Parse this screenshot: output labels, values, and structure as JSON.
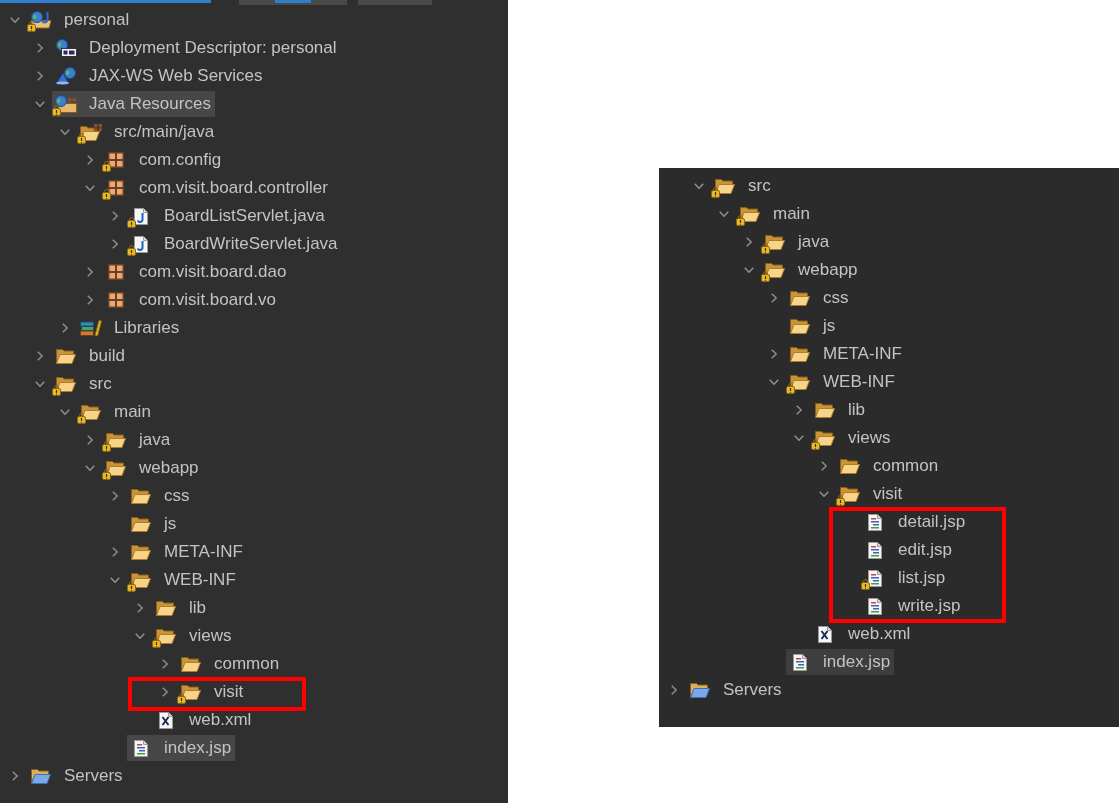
{
  "left_panel": {
    "items": [
      {
        "kind": "project",
        "label": "personal",
        "expanded": true,
        "warning": true,
        "selected": false,
        "children": [
          {
            "kind": "descriptor",
            "label": "Deployment Descriptor: personal",
            "expanded": false,
            "warning": false,
            "selected": false
          },
          {
            "kind": "web-services",
            "label": "JAX-WS Web Services",
            "expanded": false,
            "warning": false,
            "selected": false
          },
          {
            "kind": "java-resources",
            "label": "Java Resources",
            "expanded": true,
            "warning": true,
            "selected": true,
            "children": [
              {
                "kind": "source-folder",
                "label": "src/main/java",
                "expanded": true,
                "warning": true,
                "selected": false,
                "children": [
                  {
                    "kind": "package",
                    "label": "com.config",
                    "expanded": false,
                    "warning": true,
                    "selected": false
                  },
                  {
                    "kind": "package",
                    "label": "com.visit.board.controller",
                    "expanded": true,
                    "warning": true,
                    "selected": false,
                    "children": [
                      {
                        "kind": "java-file",
                        "label": "BoardListServlet.java",
                        "expanded": false,
                        "warning": true,
                        "selected": false
                      },
                      {
                        "kind": "java-file",
                        "label": "BoardWriteServlet.java",
                        "expanded": false,
                        "warning": true,
                        "selected": false
                      }
                    ]
                  },
                  {
                    "kind": "package",
                    "label": "com.visit.board.dao",
                    "expanded": false,
                    "warning": false,
                    "selected": false
                  },
                  {
                    "kind": "package",
                    "label": "com.visit.board.vo",
                    "expanded": false,
                    "warning": false,
                    "selected": false
                  }
                ]
              },
              {
                "kind": "libraries",
                "label": "Libraries",
                "expanded": false,
                "warning": false,
                "selected": false
              }
            ]
          },
          {
            "kind": "folder",
            "label": "build",
            "expanded": false,
            "warning": false,
            "selected": false
          },
          {
            "kind": "folder",
            "label": "src",
            "expanded": true,
            "warning": true,
            "selected": false,
            "children": [
              {
                "kind": "folder",
                "label": "main",
                "expanded": true,
                "warning": true,
                "selected": false,
                "children": [
                  {
                    "kind": "folder",
                    "label": "java",
                    "expanded": false,
                    "warning": true,
                    "selected": false
                  },
                  {
                    "kind": "folder",
                    "label": "webapp",
                    "expanded": true,
                    "warning": true,
                    "selected": false,
                    "children": [
                      {
                        "kind": "folder",
                        "label": "css",
                        "expanded": false,
                        "warning": false,
                        "selected": false
                      },
                      {
                        "kind": "folder",
                        "label": "js",
                        "warning": false,
                        "selected": false
                      },
                      {
                        "kind": "folder",
                        "label": "META-INF",
                        "expanded": false,
                        "warning": false,
                        "selected": false
                      },
                      {
                        "kind": "folder",
                        "label": "WEB-INF",
                        "expanded": true,
                        "warning": true,
                        "selected": false,
                        "children": [
                          {
                            "kind": "folder",
                            "label": "lib",
                            "expanded": false,
                            "warning": false,
                            "selected": false
                          },
                          {
                            "kind": "folder",
                            "label": "views",
                            "expanded": true,
                            "warning": true,
                            "selected": false,
                            "children": [
                              {
                                "kind": "folder",
                                "label": "common",
                                "expanded": false,
                                "warning": false,
                                "selected": false
                              },
                              {
                                "kind": "folder",
                                "label": "visit",
                                "expanded": false,
                                "warning": true,
                                "selected": false,
                                "boxed": true
                              }
                            ]
                          },
                          {
                            "kind": "xml-file",
                            "label": "web.xml",
                            "warning": false,
                            "selected": false
                          }
                        ]
                      },
                      {
                        "kind": "jsp-file",
                        "label": "index.jsp",
                        "warning": false,
                        "selected": true
                      }
                    ]
                  }
                ]
              }
            ]
          }
        ]
      },
      {
        "kind": "servers",
        "label": "Servers",
        "expanded": false,
        "warning": false,
        "selected": false
      }
    ]
  },
  "right_panel": {
    "project_contents": [
      {
        "kind": "folder",
        "label": "src",
        "expanded": true,
        "warning": true,
        "selected": false,
        "children": [
          {
            "kind": "folder",
            "label": "main",
            "expanded": true,
            "warning": true,
            "selected": false,
            "children": [
              {
                "kind": "folder",
                "label": "java",
                "expanded": false,
                "warning": true,
                "selected": false
              },
              {
                "kind": "folder",
                "label": "webapp",
                "expanded": true,
                "warning": true,
                "selected": false,
                "children": [
                  {
                    "kind": "folder",
                    "label": "css",
                    "expanded": false,
                    "warning": false,
                    "selected": false
                  },
                  {
                    "kind": "folder",
                    "label": "js",
                    "warning": false,
                    "selected": false
                  },
                  {
                    "kind": "folder",
                    "label": "META-INF",
                    "expanded": false,
                    "warning": false,
                    "selected": false
                  },
                  {
                    "kind": "folder",
                    "label": "WEB-INF",
                    "expanded": true,
                    "warning": true,
                    "selected": false,
                    "children": [
                      {
                        "kind": "folder",
                        "label": "lib",
                        "expanded": false,
                        "warning": false,
                        "selected": false
                      },
                      {
                        "kind": "folder",
                        "label": "views",
                        "expanded": true,
                        "warning": true,
                        "selected": false,
                        "children": [
                          {
                            "kind": "folder",
                            "label": "common",
                            "expanded": false,
                            "warning": false,
                            "selected": false
                          },
                          {
                            "kind": "folder",
                            "label": "visit",
                            "expanded": true,
                            "warning": true,
                            "selected": false,
                            "children_boxed": true,
                            "children": [
                              {
                                "kind": "jsp-file",
                                "label": "detail.jsp",
                                "warning": false,
                                "selected": false
                              },
                              {
                                "kind": "jsp-file",
                                "label": "edit.jsp",
                                "warning": false,
                                "selected": false
                              },
                              {
                                "kind": "jsp-file",
                                "label": "list.jsp",
                                "warning": true,
                                "selected": false
                              },
                              {
                                "kind": "jsp-file",
                                "label": "write.jsp",
                                "warning": false,
                                "selected": false
                              }
                            ]
                          }
                        ]
                      },
                      {
                        "kind": "xml-file",
                        "label": "web.xml",
                        "warning": false,
                        "selected": false
                      }
                    ]
                  },
                  {
                    "kind": "jsp-file",
                    "label": "index.jsp",
                    "warning": false,
                    "selected": true
                  }
                ]
              }
            ]
          }
        ]
      }
    ],
    "items": [
      {
        "kind": "servers",
        "label": "Servers",
        "expanded": false,
        "warning": false,
        "selected": false
      }
    ]
  }
}
